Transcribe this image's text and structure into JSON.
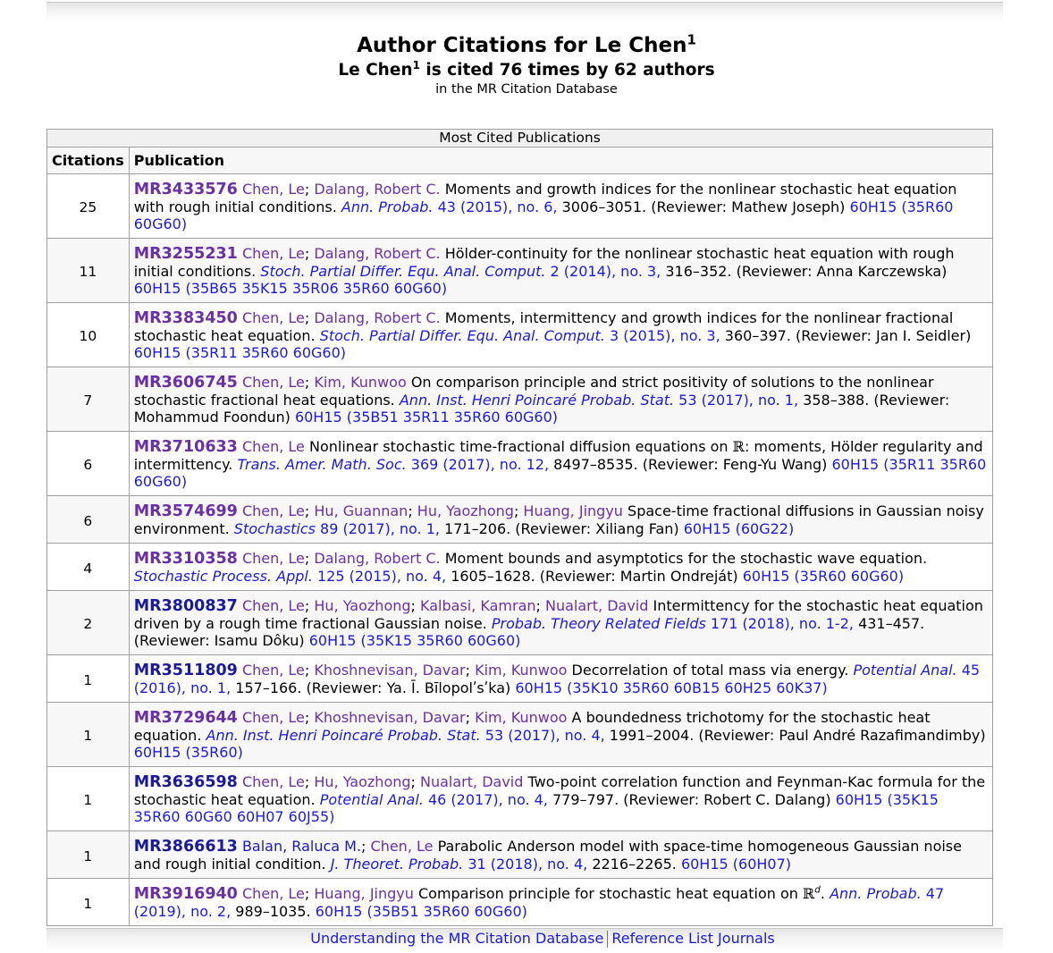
{
  "header": {
    "title": "Author Citations for Le Chen",
    "title_sup": "1",
    "subtitle_name": "Le Chen",
    "subtitle_sup": "1",
    "subtitle_rest": " is cited 76 times by 62 authors",
    "database": "in the MR Citation Database"
  },
  "table": {
    "caption": "Most Cited Publications",
    "col_citations": "Citations",
    "col_publication": "Publication",
    "rows": [
      {
        "citations": "25",
        "mr": "MR3433576",
        "authors": [
          "Chen, Le",
          "Dalang, Robert C."
        ],
        "title": "Moments and growth indices for the nonlinear stochastic heat equation with rough initial conditions.",
        "journal": "Ann. Probab.",
        "issue": "43 (2015), no. 6,",
        "pages": "3006–3051. (Reviewer: Mathew Joseph)",
        "classes": "60H15 (35R60 60G60)"
      },
      {
        "citations": "11",
        "mr": "MR3255231",
        "authors": [
          "Chen, Le",
          "Dalang, Robert C."
        ],
        "title": "Hölder-continuity for the nonlinear stochastic heat equation with rough initial conditions.",
        "journal": "Stoch. Partial Differ. Equ. Anal. Comput.",
        "issue": "2 (2014), no. 3,",
        "pages": "316–352. (Reviewer: Anna Karczewska)",
        "classes": "60H15 (35B65 35K15 35R06 35R60 60G60)"
      },
      {
        "citations": "10",
        "mr": "MR3383450",
        "authors": [
          "Chen, Le",
          "Dalang, Robert C."
        ],
        "title": "Moments, intermittency and growth indices for the nonlinear fractional stochastic heat equation.",
        "journal": "Stoch. Partial Differ. Equ. Anal. Comput.",
        "issue": "3 (2015), no. 3,",
        "pages": "360–397. (Reviewer: Jan I. Seidler)",
        "classes": "60H15 (35R11 35R60 60G60)"
      },
      {
        "citations": "7",
        "mr": "MR3606745",
        "authors": [
          "Chen, Le",
          "Kim, Kunwoo"
        ],
        "title": "On comparison principle and strict positivity of solutions to the nonlinear stochastic fractional heat equations.",
        "journal": "Ann. Inst. Henri Poincaré Probab. Stat.",
        "issue": "53 (2017), no. 1,",
        "pages": "358–388. (Reviewer: Mohammud Foondun)",
        "classes": "60H15 (35B51 35R11 35R60 60G60)"
      },
      {
        "citations": "6",
        "mr": "MR3710633",
        "authors": [
          "Chen, Le"
        ],
        "title_pre": "Nonlinear stochastic time-fractional diffusion equations on ",
        "title_sym": "ℝ",
        "title_post": ": moments, Hölder regularity and intermittency.",
        "journal": "Trans. Amer. Math. Soc.",
        "issue": "369 (2017), no. 12,",
        "pages": "8497–8535. (Reviewer: Feng-Yu Wang)",
        "classes": "60H15 (35R11 35R60 60G60)"
      },
      {
        "citations": "6",
        "mr": "MR3574699",
        "authors": [
          "Chen, Le",
          "Hu, Guannan",
          "Hu, Yaozhong",
          "Huang, Jingyu"
        ],
        "title": "Space-time fractional diffusions in Gaussian noisy environment.",
        "journal": "Stochastics",
        "issue": "89 (2017), no. 1,",
        "pages": "171–206. (Reviewer: Xiliang Fan)",
        "classes": "60H15 (60G22)"
      },
      {
        "citations": "4",
        "mr": "MR3310358",
        "authors": [
          "Chen, Le",
          "Dalang, Robert C."
        ],
        "title": "Moment bounds and asymptotics for the stochastic wave equation.",
        "journal": "Stochastic Process. Appl.",
        "issue": "125 (2015), no. 4,",
        "pages": "1605–1628. (Reviewer: Martin Ondreját)",
        "classes": "60H15 (35R60 60G60)"
      },
      {
        "citations": "2",
        "mr": "MR3800837",
        "authors": [
          "Chen, Le",
          "Hu, Yaozhong",
          "Kalbasi, Kamran",
          "Nualart, David"
        ],
        "title": "Intermittency for the stochastic heat equation driven by a rough time fractional Gaussian noise.",
        "journal": "Probab. Theory Related Fields",
        "issue": "171 (2018), no. 1-2,",
        "pages": "431–457. (Reviewer: Isamu Dôku)",
        "classes": "60H15 (35K15 35R60 60G60)"
      },
      {
        "citations": "1",
        "mr": "MR3511809",
        "authors": [
          "Chen, Le",
          "Khoshnevisan, Davar",
          "Kim, Kunwoo"
        ],
        "title": "Decorrelation of total mass via energy.",
        "journal": "Potential Anal.",
        "issue": "45 (2016), no. 1,",
        "pages": "157–166. (Reviewer: Ya. Ī. Bīlopolʹsʹka)",
        "classes": "60H15 (35K10 35R60 60B15 60H25 60K37)"
      },
      {
        "citations": "1",
        "mr": "MR3729644",
        "authors": [
          "Chen, Le",
          "Khoshnevisan, Davar",
          "Kim, Kunwoo"
        ],
        "title": "A boundedness trichotomy for the stochastic heat equation.",
        "journal": "Ann. Inst. Henri Poincaré Probab. Stat.",
        "issue": "53 (2017), no. 4,",
        "pages": "1991–2004. (Reviewer: Paul André Razafimandimby)",
        "classes": "60H15 (35R60)"
      },
      {
        "citations": "1",
        "mr": "MR3636598",
        "authors": [
          "Chen, Le",
          "Hu, Yaozhong",
          "Nualart, David"
        ],
        "title": "Two-point correlation function and Feynman-Kac formula for the stochastic heat equation.",
        "journal": "Potential Anal.",
        "issue": "46 (2017), no. 4,",
        "pages": "779–797. (Reviewer: Robert C. Dalang)",
        "classes": "60H15 (35K15 35R60 60G60 60H07 60J55)"
      },
      {
        "citations": "1",
        "mr": "MR3866613",
        "authors": [
          "Balan, Raluca M.",
          "Chen, Le"
        ],
        "title": "Parabolic Anderson model with space-time homogeneous Gaussian noise and rough initial condition.",
        "journal": "J. Theoret. Probab.",
        "issue": "31 (2018), no. 4,",
        "pages": "2216–2265.",
        "classes": "60H15 (60H07)"
      },
      {
        "citations": "1",
        "mr": "MR3916940",
        "authors": [
          "Chen, Le",
          "Huang, Jingyu"
        ],
        "title_pre": "Comparison principle for stochastic heat equation on ",
        "title_sym": "ℝ",
        "title_sup": "d",
        "title_post": ".",
        "journal": "Ann. Probab.",
        "issue": "47 (2019), no. 2,",
        "pages": "989–1035.",
        "classes": "60H15 (35B51 35R60 60G60)"
      }
    ]
  },
  "footer": {
    "link1": "Understanding the MR Citation Database",
    "link2": "Reference List Journals"
  },
  "colors": {
    "visited_link": "#6b30a5",
    "link": "#1a1ae0",
    "unvisited_mr": "#1a1a9e"
  }
}
